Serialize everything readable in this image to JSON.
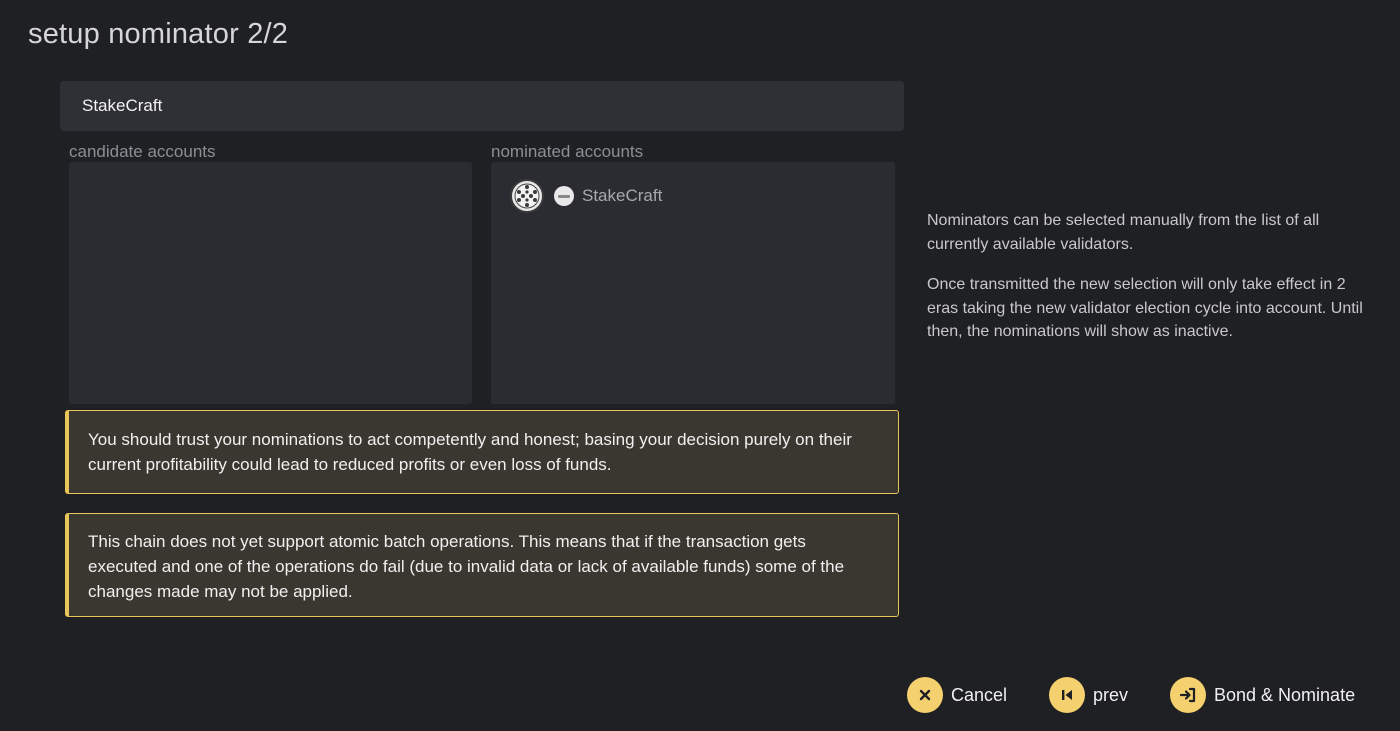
{
  "page": {
    "title": "setup nominator 2/2"
  },
  "search": {
    "value": "StakeCraft"
  },
  "candidate": {
    "label": "candidate accounts"
  },
  "nominated": {
    "label": "nominated accounts",
    "items": [
      {
        "name": "StakeCraft"
      }
    ]
  },
  "warnings": [
    "You should trust your nominations to act competently and honest; basing your decision purely on their current profitability could lead to reduced profits or even loss of funds.",
    "This chain does not yet support atomic batch operations. This means that if the transaction gets executed and one of the operations do fail (due to invalid data or lack of available funds) some of the changes made may not be applied."
  ],
  "help": [
    "Nominators can be selected manually from the list of all currently available validators.",
    "Once transmitted the new selection will only take effect in 2 eras taking the new validator election cycle into account. Until then, the nominations will show as inactive."
  ],
  "actions": {
    "cancel": "Cancel",
    "prev": "prev",
    "bond": "Bond & Nominate"
  },
  "colors": {
    "accent": "#f4d06f",
    "warning_border": "#e8c559",
    "background": "#1f2024",
    "panel": "#2b2c32"
  },
  "icons": {
    "cancel": "x-circle-icon",
    "prev": "step-backward-icon",
    "bond": "sign-in-icon",
    "identicon": "identicon",
    "identity": "identity-badge-icon"
  }
}
